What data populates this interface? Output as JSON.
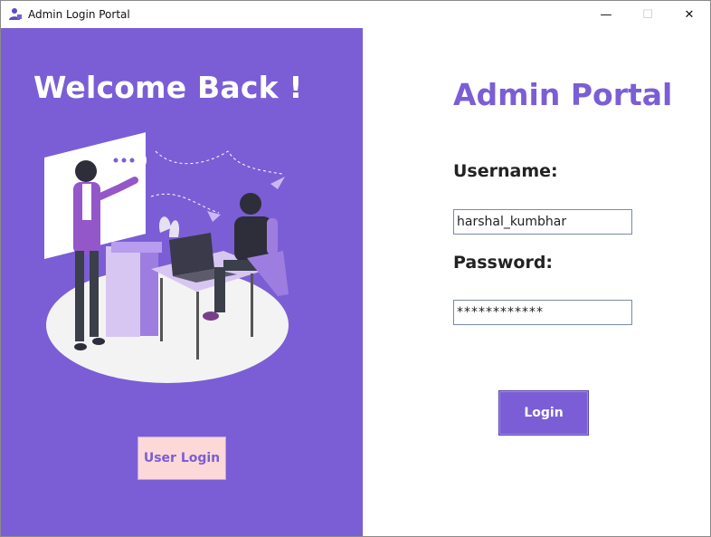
{
  "window": {
    "title": "Admin Login Portal",
    "controls": {
      "minimize": "—",
      "maximize": "☐",
      "close": "✕"
    }
  },
  "left": {
    "welcome": "Welcome Back !",
    "user_login_label": "User Login",
    "illustration_icon": "people-at-desk-illustration"
  },
  "right": {
    "title": "Admin Portal",
    "username_label": "Username:",
    "username_value": "harshal_kumbhar",
    "password_label": "Password:",
    "password_value": "************",
    "login_label": "Login"
  },
  "colors": {
    "accent": "#7b5ed5",
    "user_login_bg": "#fcd8d8"
  }
}
